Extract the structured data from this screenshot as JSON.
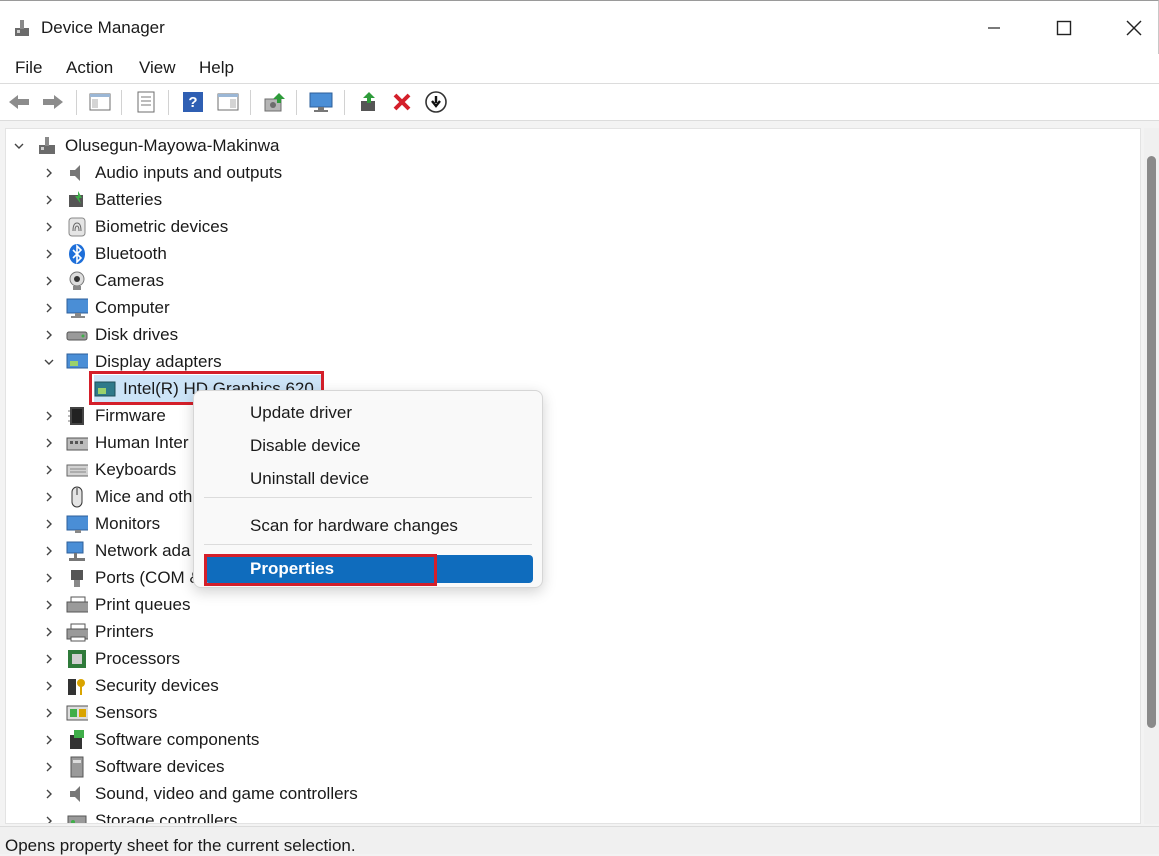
{
  "window": {
    "title": "Device Manager"
  },
  "menu": [
    "File",
    "Action",
    "View",
    "Help"
  ],
  "tree": {
    "root": "Olusegun-Mayowa-Makinwa",
    "categories": [
      "Audio inputs and outputs",
      "Batteries",
      "Biometric devices",
      "Bluetooth",
      "Cameras",
      "Computer",
      "Disk drives",
      "Display adapters",
      "Firmware",
      "Human Inter",
      "Keyboards",
      "Mice and oth",
      "Monitors",
      "Network ada",
      "Ports (COM &",
      "Print queues",
      "Printers",
      "Processors",
      "Security devices",
      "Sensors",
      "Software components",
      "Software devices",
      "Sound, video and game controllers",
      "Storage controllers"
    ],
    "selected_device": "Intel(R) HD Graphics 620"
  },
  "context_menu": {
    "items": [
      "Update driver",
      "Disable device",
      "Uninstall device",
      "Scan for hardware changes",
      "Properties"
    ],
    "highlighted": "Properties"
  },
  "status": {
    "text": "Opens property sheet for the current selection."
  },
  "colors": {
    "accent": "#0f6cbd",
    "highlight_box": "#d41f2a",
    "delete_icon": "#d41f2a"
  }
}
